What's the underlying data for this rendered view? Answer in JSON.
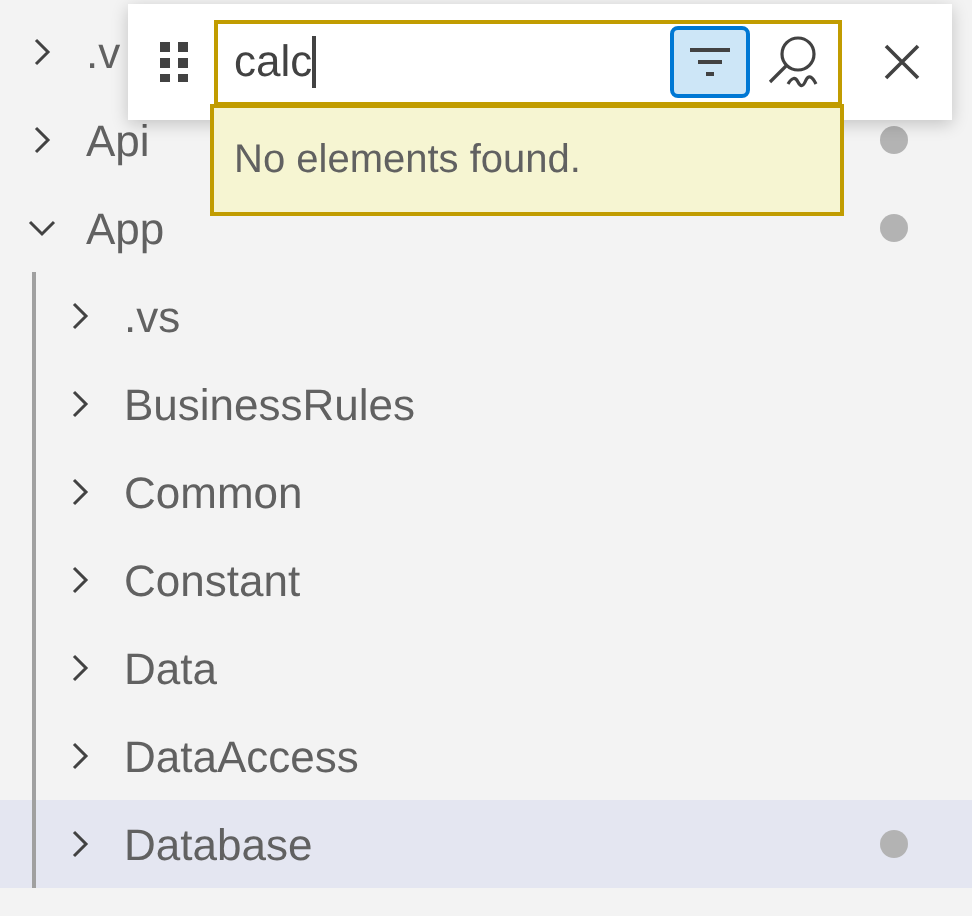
{
  "find_widget": {
    "query": "calc",
    "filter_on_type": {
      "selected": true
    },
    "fuzzy_match": {
      "selected": false
    },
    "message": "No elements found."
  },
  "tree": [
    {
      "label": ".v",
      "expanded": false,
      "selected": false
    },
    {
      "label": "Api",
      "expanded": false,
      "modified": true,
      "selected": false
    },
    {
      "label": "App",
      "expanded": true,
      "modified": true,
      "selected": false,
      "children": [
        {
          "label": ".vs",
          "expanded": false,
          "modified": false,
          "selected": false
        },
        {
          "label": "BusinessRules",
          "expanded": false,
          "modified": false,
          "selected": false
        },
        {
          "label": "Common",
          "expanded": false,
          "modified": false,
          "selected": false
        },
        {
          "label": "Constant",
          "expanded": false,
          "modified": false,
          "selected": false
        },
        {
          "label": "Data",
          "expanded": false,
          "modified": false,
          "selected": false
        },
        {
          "label": "DataAccess",
          "expanded": false,
          "modified": false,
          "selected": false
        },
        {
          "label": "Database",
          "expanded": false,
          "modified": true,
          "selected": true
        }
      ]
    }
  ]
}
